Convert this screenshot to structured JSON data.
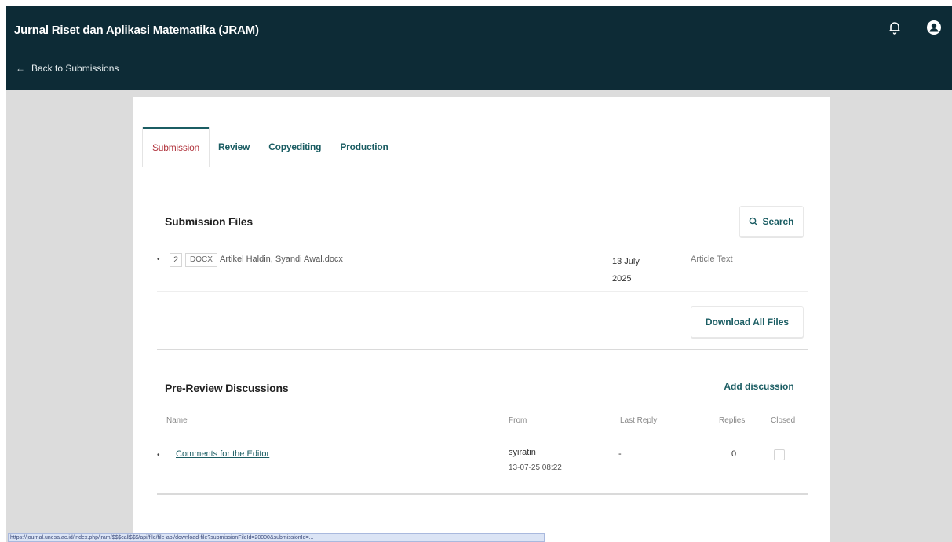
{
  "header": {
    "title": "Jurnal Riset dan Aplikasi Matematika (JRAM)",
    "back_label": "Back to Submissions"
  },
  "tabs": [
    {
      "label": "Submission"
    },
    {
      "label": "Review"
    },
    {
      "label": "Copyediting"
    },
    {
      "label": "Production"
    }
  ],
  "submission_files": {
    "title": "Submission Files",
    "search_label": "Search",
    "download_label": "Download All Files",
    "files": [
      {
        "id": "2",
        "ext": "DOCX",
        "name": "Artikel Haldin, Syandi Awal.docx",
        "date": "13 July 2025",
        "type": "Article Text"
      }
    ]
  },
  "discussions": {
    "title": "Pre-Review Discussions",
    "add_label": "Add discussion",
    "columns": [
      "Name",
      "From",
      "Last Reply",
      "Replies",
      "Closed"
    ],
    "rows": [
      {
        "name": "Comments for the Editor",
        "from_user": "syiratin",
        "from_date": "13-07-25 08:22",
        "last_reply": "-",
        "replies": "0"
      }
    ]
  },
  "status_url": "https://journal.unesa.ac.id/index.php/jram/$$$call$$$/api/file/file-api/download-file?submissionFileId=20000&submissionId=..."
}
